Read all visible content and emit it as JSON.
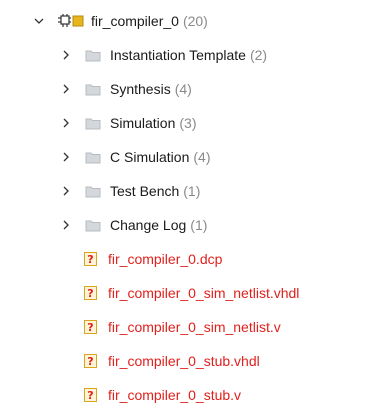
{
  "tree": {
    "root": {
      "label": "fir_compiler_0",
      "count": "(20)",
      "icon": "ip-core-icon",
      "expanded": true
    },
    "folders": [
      {
        "label": "Instantiation Template",
        "count": "(2)",
        "icon": "folder-icon"
      },
      {
        "label": "Synthesis",
        "count": "(4)",
        "icon": "folder-icon"
      },
      {
        "label": "Simulation",
        "count": "(3)",
        "icon": "folder-icon"
      },
      {
        "label": "C Simulation",
        "count": "(4)",
        "icon": "folder-icon"
      },
      {
        "label": "Test Bench",
        "count": "(1)",
        "icon": "folder-icon"
      },
      {
        "label": "Change Log",
        "count": "(1)",
        "icon": "folder-icon"
      }
    ],
    "files": [
      {
        "label": "fir_compiler_0.dcp",
        "icon": "missing-file-icon"
      },
      {
        "label": "fir_compiler_0_sim_netlist.vhdl",
        "icon": "missing-file-icon"
      },
      {
        "label": "fir_compiler_0_sim_netlist.v",
        "icon": "missing-file-icon"
      },
      {
        "label": "fir_compiler_0_stub.vhdl",
        "icon": "missing-file-icon"
      },
      {
        "label": "fir_compiler_0_stub.v",
        "icon": "missing-file-icon"
      }
    ]
  },
  "colors": {
    "missing_file_text": "#e0211d",
    "count_text": "#8a8a8a",
    "folder": "#d4d8dc",
    "ip_core_accent": "#e8b51a"
  }
}
